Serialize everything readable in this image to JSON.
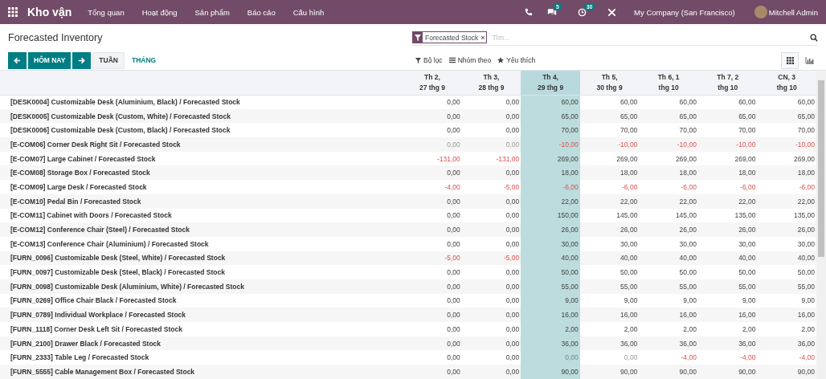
{
  "navbar": {
    "app_title": "Kho vận",
    "menu": [
      "Tổng quan",
      "Hoạt động",
      "Sản phẩm",
      "Báo cáo",
      "Cấu hình"
    ],
    "messages_badge": "5",
    "activities_badge": "30",
    "company": "My Company (San Francisco)",
    "user": "Mitchell Admin"
  },
  "control_panel": {
    "title": "Forecasted Inventory",
    "search": {
      "facet": "Forecasted Stock",
      "remove": "×",
      "placeholder": "Tìm..."
    },
    "today_button": "HÔM NAY",
    "scales": [
      {
        "label": "TUẦN",
        "selected": true
      },
      {
        "label": "THÁNG",
        "selected": false
      }
    ],
    "filters": [
      "Bộ lọc",
      "Nhóm theo",
      "Yêu thích"
    ],
    "views": [
      {
        "kind": "grid",
        "selected": true
      },
      {
        "kind": "graph",
        "selected": false
      }
    ]
  },
  "table": {
    "columns": [
      {
        "line_1": "Th 2,",
        "line_2": "27 thg 9",
        "selected": false
      },
      {
        "line_1": "Th 3,",
        "line_2": "28 thg 9",
        "selected": false
      },
      {
        "line_1": "Th 4,",
        "line_2": "29 thg 9",
        "selected": true
      },
      {
        "line_1": "Th 5,",
        "line_2": "30 thg 9",
        "selected": false
      },
      {
        "line_1": "Th 6, 1",
        "line_2": "thg 10",
        "selected": false
      },
      {
        "line_1": "Th 7, 2",
        "line_2": "thg 10",
        "selected": false
      },
      {
        "line_1": "CN, 3",
        "line_2": "thg 10",
        "selected": false
      }
    ],
    "rows": [
      {
        "label": "[DESK0004] Customizable Desk (Aluminium, Black) / Forecasted Stock",
        "cells": [
          {
            "text": "0,00",
            "kind": "plain"
          },
          {
            "text": "0,00",
            "kind": "plain"
          },
          {
            "text": "60,00",
            "kind": "plain"
          },
          {
            "text": "60,00",
            "kind": "plain"
          },
          {
            "text": "60,00",
            "kind": "plain"
          },
          {
            "text": "60,00",
            "kind": "plain"
          },
          {
            "text": "60,00",
            "kind": "plain"
          }
        ]
      },
      {
        "label": "[DESK0005] Customizable Desk (Custom, White) / Forecasted Stock",
        "cells": [
          {
            "text": "0,00",
            "kind": "plain"
          },
          {
            "text": "0,00",
            "kind": "plain"
          },
          {
            "text": "65,00",
            "kind": "plain"
          },
          {
            "text": "65,00",
            "kind": "plain"
          },
          {
            "text": "65,00",
            "kind": "plain"
          },
          {
            "text": "65,00",
            "kind": "plain"
          },
          {
            "text": "65,00",
            "kind": "plain"
          }
        ]
      },
      {
        "label": "[DESK0006] Customizable Desk (Custom, Black) / Forecasted Stock",
        "cells": [
          {
            "text": "0,00",
            "kind": "plain"
          },
          {
            "text": "0,00",
            "kind": "plain"
          },
          {
            "text": "70,00",
            "kind": "plain"
          },
          {
            "text": "70,00",
            "kind": "plain"
          },
          {
            "text": "70,00",
            "kind": "plain"
          },
          {
            "text": "70,00",
            "kind": "plain"
          },
          {
            "text": "70,00",
            "kind": "plain"
          }
        ]
      },
      {
        "label": "[E-COM06] Corner Desk Right Sit / Forecasted Stock",
        "cells": [
          {
            "text": "0,00",
            "kind": "muted"
          },
          {
            "text": "0,00",
            "kind": "muted"
          },
          {
            "text": "-10,00",
            "kind": "negative"
          },
          {
            "text": "-10,00",
            "kind": "negative"
          },
          {
            "text": "-10,00",
            "kind": "negative"
          },
          {
            "text": "-10,00",
            "kind": "negative"
          },
          {
            "text": "-10,00",
            "kind": "negative"
          }
        ]
      },
      {
        "label": "[E-COM07] Large Cabinet / Forecasted Stock",
        "cells": [
          {
            "text": "-131,00",
            "kind": "negative"
          },
          {
            "text": "-131,00",
            "kind": "negative"
          },
          {
            "text": "269,00",
            "kind": "plain"
          },
          {
            "text": "269,00",
            "kind": "plain"
          },
          {
            "text": "269,00",
            "kind": "plain"
          },
          {
            "text": "269,00",
            "kind": "plain"
          },
          {
            "text": "269,00",
            "kind": "plain"
          }
        ]
      },
      {
        "label": "[E-COM08] Storage Box / Forecasted Stock",
        "cells": [
          {
            "text": "0,00",
            "kind": "plain"
          },
          {
            "text": "0,00",
            "kind": "plain"
          },
          {
            "text": "18,00",
            "kind": "plain"
          },
          {
            "text": "18,00",
            "kind": "plain"
          },
          {
            "text": "18,00",
            "kind": "plain"
          },
          {
            "text": "18,00",
            "kind": "plain"
          },
          {
            "text": "18,00",
            "kind": "plain"
          }
        ]
      },
      {
        "label": "[E-COM09] Large Desk / Forecasted Stock",
        "cells": [
          {
            "text": "-4,00",
            "kind": "negative"
          },
          {
            "text": "-5,00",
            "kind": "negative"
          },
          {
            "text": "-6,00",
            "kind": "negative"
          },
          {
            "text": "-6,00",
            "kind": "negative"
          },
          {
            "text": "-6,00",
            "kind": "negative"
          },
          {
            "text": "-6,00",
            "kind": "negative"
          },
          {
            "text": "-6,00",
            "kind": "negative"
          }
        ]
      },
      {
        "label": "[E-COM10] Pedal Bin / Forecasted Stock",
        "cells": [
          {
            "text": "0,00",
            "kind": "plain"
          },
          {
            "text": "0,00",
            "kind": "plain"
          },
          {
            "text": "22,00",
            "kind": "plain"
          },
          {
            "text": "22,00",
            "kind": "plain"
          },
          {
            "text": "22,00",
            "kind": "plain"
          },
          {
            "text": "22,00",
            "kind": "plain"
          },
          {
            "text": "22,00",
            "kind": "plain"
          }
        ]
      },
      {
        "label": "[E-COM11] Cabinet with Doors / Forecasted Stock",
        "cells": [
          {
            "text": "0,00",
            "kind": "plain"
          },
          {
            "text": "0,00",
            "kind": "plain"
          },
          {
            "text": "150,00",
            "kind": "plain"
          },
          {
            "text": "145,00",
            "kind": "plain"
          },
          {
            "text": "145,00",
            "kind": "plain"
          },
          {
            "text": "135,00",
            "kind": "plain"
          },
          {
            "text": "135,00",
            "kind": "plain"
          }
        ]
      },
      {
        "label": "[E-COM12] Conference Chair (Steel) / Forecasted Stock",
        "cells": [
          {
            "text": "0,00",
            "kind": "plain"
          },
          {
            "text": "0,00",
            "kind": "plain"
          },
          {
            "text": "26,00",
            "kind": "plain"
          },
          {
            "text": "26,00",
            "kind": "plain"
          },
          {
            "text": "26,00",
            "kind": "plain"
          },
          {
            "text": "26,00",
            "kind": "plain"
          },
          {
            "text": "26,00",
            "kind": "plain"
          }
        ]
      },
      {
        "label": "[E-COM13] Conference Chair (Aluminium) / Forecasted Stock",
        "cells": [
          {
            "text": "0,00",
            "kind": "plain"
          },
          {
            "text": "0,00",
            "kind": "plain"
          },
          {
            "text": "30,00",
            "kind": "plain"
          },
          {
            "text": "30,00",
            "kind": "plain"
          },
          {
            "text": "30,00",
            "kind": "plain"
          },
          {
            "text": "30,00",
            "kind": "plain"
          },
          {
            "text": "30,00",
            "kind": "plain"
          }
        ]
      },
      {
        "label": "[FURN_0096] Customizable Desk (Steel, White) / Forecasted Stock",
        "cells": [
          {
            "text": "-5,00",
            "kind": "negative"
          },
          {
            "text": "-5,00",
            "kind": "negative"
          },
          {
            "text": "40,00",
            "kind": "plain"
          },
          {
            "text": "40,00",
            "kind": "plain"
          },
          {
            "text": "40,00",
            "kind": "plain"
          },
          {
            "text": "40,00",
            "kind": "plain"
          },
          {
            "text": "40,00",
            "kind": "plain"
          }
        ]
      },
      {
        "label": "[FURN_0097] Customizable Desk (Steel, Black) / Forecasted Stock",
        "cells": [
          {
            "text": "0,00",
            "kind": "plain"
          },
          {
            "text": "0,00",
            "kind": "plain"
          },
          {
            "text": "50,00",
            "kind": "plain"
          },
          {
            "text": "50,00",
            "kind": "plain"
          },
          {
            "text": "50,00",
            "kind": "plain"
          },
          {
            "text": "50,00",
            "kind": "plain"
          },
          {
            "text": "50,00",
            "kind": "plain"
          }
        ]
      },
      {
        "label": "[FURN_0098] Customizable Desk (Aluminium, White) / Forecasted Stock",
        "cells": [
          {
            "text": "0,00",
            "kind": "plain"
          },
          {
            "text": "0,00",
            "kind": "plain"
          },
          {
            "text": "55,00",
            "kind": "plain"
          },
          {
            "text": "55,00",
            "kind": "plain"
          },
          {
            "text": "55,00",
            "kind": "plain"
          },
          {
            "text": "55,00",
            "kind": "plain"
          },
          {
            "text": "55,00",
            "kind": "plain"
          }
        ]
      },
      {
        "label": "[FURN_0269] Office Chair Black / Forecasted Stock",
        "cells": [
          {
            "text": "0,00",
            "kind": "plain"
          },
          {
            "text": "0,00",
            "kind": "plain"
          },
          {
            "text": "9,00",
            "kind": "plain"
          },
          {
            "text": "9,00",
            "kind": "plain"
          },
          {
            "text": "9,00",
            "kind": "plain"
          },
          {
            "text": "9,00",
            "kind": "plain"
          },
          {
            "text": "9,00",
            "kind": "plain"
          }
        ]
      },
      {
        "label": "[FURN_0789] Individual Workplace / Forecasted Stock",
        "cells": [
          {
            "text": "0,00",
            "kind": "plain"
          },
          {
            "text": "0,00",
            "kind": "plain"
          },
          {
            "text": "16,00",
            "kind": "plain"
          },
          {
            "text": "16,00",
            "kind": "plain"
          },
          {
            "text": "16,00",
            "kind": "plain"
          },
          {
            "text": "16,00",
            "kind": "plain"
          },
          {
            "text": "16,00",
            "kind": "plain"
          }
        ]
      },
      {
        "label": "[FURN_1118] Corner Desk Left Sit / Forecasted Stock",
        "cells": [
          {
            "text": "0,00",
            "kind": "plain"
          },
          {
            "text": "0,00",
            "kind": "plain"
          },
          {
            "text": "2,00",
            "kind": "plain"
          },
          {
            "text": "2,00",
            "kind": "plain"
          },
          {
            "text": "2,00",
            "kind": "plain"
          },
          {
            "text": "2,00",
            "kind": "plain"
          },
          {
            "text": "2,00",
            "kind": "plain"
          }
        ]
      },
      {
        "label": "[FURN_2100] Drawer Black / Forecasted Stock",
        "cells": [
          {
            "text": "0,00",
            "kind": "plain"
          },
          {
            "text": "0,00",
            "kind": "plain"
          },
          {
            "text": "36,00",
            "kind": "plain"
          },
          {
            "text": "36,00",
            "kind": "plain"
          },
          {
            "text": "36,00",
            "kind": "plain"
          },
          {
            "text": "36,00",
            "kind": "plain"
          },
          {
            "text": "36,00",
            "kind": "plain"
          }
        ]
      },
      {
        "label": "[FURN_2333] Table Leg / Forecasted Stock",
        "cells": [
          {
            "text": "0,00",
            "kind": "plain"
          },
          {
            "text": "0,00",
            "kind": "plain"
          },
          {
            "text": "0,00",
            "kind": "muted"
          },
          {
            "text": "0,00",
            "kind": "muted"
          },
          {
            "text": "-4,00",
            "kind": "negative"
          },
          {
            "text": "-4,00",
            "kind": "negative"
          },
          {
            "text": "-4,00",
            "kind": "negative"
          }
        ]
      },
      {
        "label": "[FURN_5555] Cable Management Box / Forecasted Stock",
        "cells": [
          {
            "text": "0,00",
            "kind": "plain"
          },
          {
            "text": "0,00",
            "kind": "plain"
          },
          {
            "text": "90,00",
            "kind": "plain"
          },
          {
            "text": "90,00",
            "kind": "plain"
          },
          {
            "text": "90,00",
            "kind": "plain"
          },
          {
            "text": "90,00",
            "kind": "plain"
          },
          {
            "text": "90,00",
            "kind": "plain"
          }
        ]
      }
    ]
  }
}
